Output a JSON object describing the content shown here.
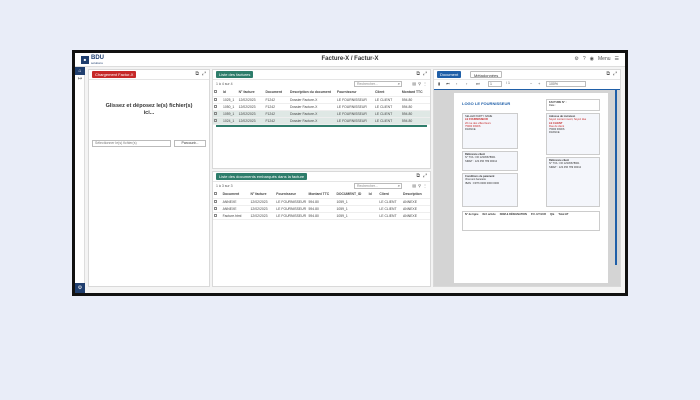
{
  "app": {
    "logo_text": "BDU",
    "logo_sub": "solutions",
    "title": "Facture-X / Factur-X",
    "lang": "Menu"
  },
  "upload_panel": {
    "tab_label": "Chargement Factur-X",
    "drop_text": "Glissez et déposez le(s) fichier(s) ici...",
    "file_placeholder": "Sélectionner le(s) fichier(s)",
    "browse_label": "Parcourir..."
  },
  "invoice_panel": {
    "tab_label": "Liste des factures",
    "count": "1 à 4 sur 4",
    "search_placeholder": "Rechercher...",
    "columns": [
      "",
      "Id",
      "N° facture",
      "Document",
      "Description du document",
      "Fournisseur",
      "Client",
      "Montant TTC"
    ],
    "rows": [
      {
        "id": "1025_1",
        "num": "12/02/2023",
        "doc": "F1242",
        "desc": "Dossier Facture-X",
        "supplier": "LE FOURNISSEUR",
        "client": "LE CLIENT",
        "amount": "594.80",
        "selected": false
      },
      {
        "id": "1050_1",
        "num": "12/02/2023",
        "doc": "F1242",
        "desc": "Dossier Facture-X",
        "supplier": "LE FOURNISSEUR",
        "client": "LE CLIENT",
        "amount": "594.80",
        "selected": false
      },
      {
        "id": "1059_1",
        "num": "12/02/2023",
        "doc": "F1242",
        "desc": "Dossier Facture-X",
        "supplier": "LE FOURNISSEUR",
        "client": "LE CLIENT",
        "amount": "594.80",
        "selected": true
      },
      {
        "id": "1024_1",
        "num": "12/02/2023",
        "doc": "F1242",
        "desc": "Dossier Facture-X",
        "supplier": "LE FOURNISSEUR",
        "client": "LE CLIENT",
        "amount": "594.80",
        "selected": true
      }
    ]
  },
  "attached_panel": {
    "tab_label": "Liste des documents embarqués dans la facture",
    "count": "1 à 3 sur 3",
    "search_placeholder": "Rechercher...",
    "columns": [
      "",
      "Document",
      "N° facture",
      "Fournisseur",
      "Montant TTC",
      "DOCUMENT_ID",
      "Id",
      "Client",
      "Description"
    ],
    "rows": [
      {
        "doc": "ANNEXE",
        "num": "12/02/2023",
        "supplier": "LE FOURNISSEUR",
        "amount": "594.80",
        "docid": "1059_1",
        "id": "",
        "client": "LE CLIENT",
        "desc": "ANNEXE"
      },
      {
        "doc": "ANNEXE",
        "num": "12/02/2023",
        "supplier": "LE FOURNISSEUR",
        "amount": "594.80",
        "docid": "1059_1",
        "id": "",
        "client": "LE CLIENT",
        "desc": "ANNEXE"
      },
      {
        "doc": "Facture.html",
        "num": "12/02/2023",
        "supplier": "LE FOURNISSEUR",
        "amount": "594.80",
        "docid": "1059_1",
        "id": "",
        "client": "LE CLIENT",
        "desc": "ANNEXE"
      }
    ]
  },
  "viewer": {
    "tab_label": "Document",
    "tab2_label": "Métadonnées",
    "page": "1",
    "page_total": "/ 1",
    "zoom": "100%",
    "doc_title": "LOGO LE FOURNISSEUR",
    "invoice_label": "FACTURE N° :",
    "date_label": "Date :",
    "supplier_lines": [
      "SELLER PARTY NAME",
      "LE FOURNISSEUR",
      "20 rue des villes fleurs",
      "75000 PARIS",
      "FRANCE"
    ],
    "buyer_lines": [
      "Adresse de Livraison",
      "Soyez content merci, Soyez dsa",
      "LE CLIENT",
      "Rue du client",
      "75000 PARIS",
      "FRANCE"
    ],
    "references": [
      "Référence client",
      "N° TVA : FR 12345678901",
      "SIRET : 123 456 789 00012"
    ],
    "payment": [
      "Conditions de paiement",
      "Virement bancaire",
      "IBAN : FR76 0000 0000 0000"
    ],
    "table_headers": [
      "N° de ligne",
      "Réf. article",
      "NOM & DÉSIGNATION",
      "P.U. HT EUR",
      "Qté",
      "Total HT"
    ]
  }
}
